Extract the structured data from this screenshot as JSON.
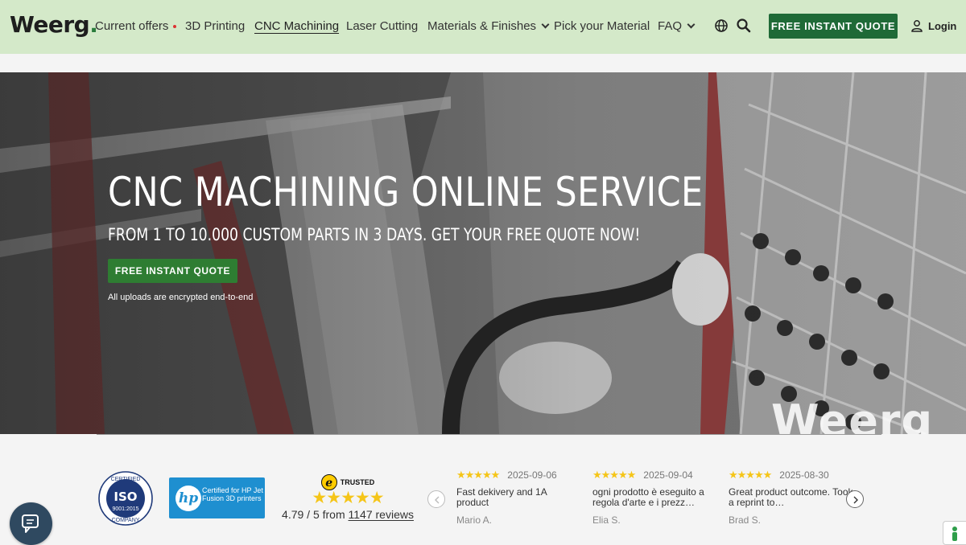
{
  "header": {
    "logo_text": "Weerg",
    "logo_dot": ".",
    "nav": [
      {
        "label": "Current offers",
        "has_dot": true
      },
      {
        "label": "3D Printing"
      },
      {
        "label": "CNC Machining",
        "active": true
      },
      {
        "label": "Laser Cutting"
      },
      {
        "label": "Materials & Finishes",
        "has_chevron": true
      },
      {
        "label": "Pick your Material"
      },
      {
        "label": "FAQ",
        "has_chevron": true
      }
    ],
    "icons": [
      "globe-icon",
      "search-icon"
    ],
    "cta_label": "FREE INSTANT QUOTE",
    "login_label": "Login"
  },
  "hero": {
    "title": "CNC MACHINING ONLINE SERVICE",
    "subtitle": "FROM 1 TO 10.000 CUSTOM PARTS IN 3 DAYS. GET YOUR FREE QUOTE NOW!",
    "cta_label": "FREE INSTANT QUOTE",
    "note": "All uploads are encrypted end-to-end",
    "watermark": "Weerg"
  },
  "trust": {
    "iso": {
      "top": "CERTIFIED",
      "main": "ISO",
      "code": "9001:2015",
      "bottom": "COMPANY"
    },
    "hp": {
      "logo": "hp",
      "text": "Certified for HP Jet Fusion 3D printers"
    },
    "trusted_shops": {
      "logo_letter": "e",
      "badge_label": "TRUSTED",
      "stars": "★★★★★",
      "rating_text": "4.79 / 5 from",
      "reviews_link": "1147 reviews"
    },
    "reviews": [
      {
        "stars": "★★★★★",
        "date": "2025-09-06",
        "text": "Fast dekivery and 1A product",
        "author": "Mario A."
      },
      {
        "stars": "★★★★★",
        "date": "2025-09-04",
        "text": "ogni prodotto è eseguito a regola d'arte e i prezz…",
        "author": "Elia S."
      },
      {
        "stars": "★★★★★",
        "date": "2025-08-30",
        "text": "Great product outcome. Took a reprint to…",
        "author": "Brad S."
      }
    ]
  },
  "colors": {
    "header_bg": "#d4e9c9",
    "primary_green": "#1f6a37",
    "hero_cta_green": "#2e7d32",
    "star_yellow": "#f5c518",
    "hp_blue": "#1e8fd0",
    "chat_bg": "#2f4960"
  },
  "floating": {
    "chat_icon": "chat-icon",
    "side_icon": "person-icon"
  }
}
